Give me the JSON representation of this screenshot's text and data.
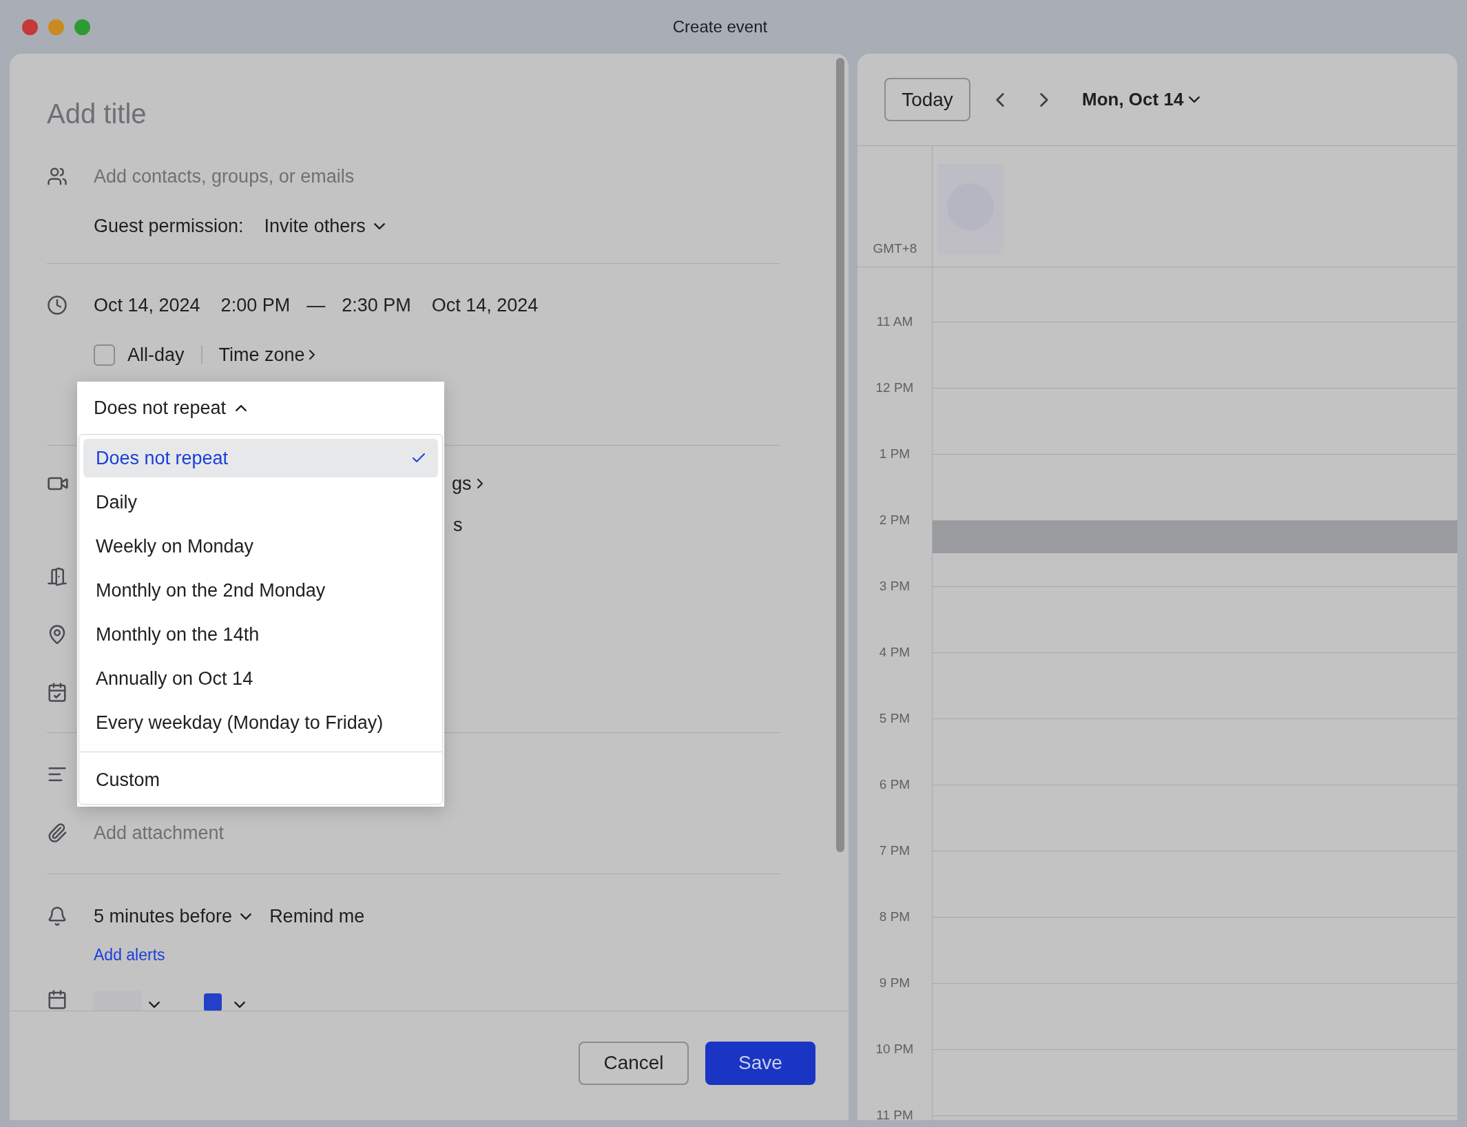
{
  "window": {
    "title": "Create event"
  },
  "form": {
    "title_placeholder": "Add title",
    "guests_placeholder": "Add contacts, groups, or emails",
    "guest_permission": {
      "label": "Guest permission:",
      "value": "Invite others"
    },
    "date_time": {
      "start_date": "Oct 14, 2024",
      "start_time": "2:00 PM",
      "separator": "—",
      "end_time": "2:30 PM",
      "end_date": "Oct 14, 2024"
    },
    "all_day": {
      "label": "All-day",
      "checked": false
    },
    "time_zone": "Time zone",
    "repeat": {
      "value": "Does not repeat",
      "expanded": true,
      "options": [
        {
          "label": "Does not repeat",
          "selected": true,
          "divider_before": false
        },
        {
          "label": "Daily",
          "selected": false,
          "divider_before": false
        },
        {
          "label": "Weekly on Monday",
          "selected": false,
          "divider_before": false
        },
        {
          "label": "Monthly on the 2nd Monday",
          "selected": false,
          "divider_before": false
        },
        {
          "label": "Monthly on the 14th",
          "selected": false,
          "divider_before": false
        },
        {
          "label": "Annually on Oct 14",
          "selected": false,
          "divider_before": false
        },
        {
          "label": "Every weekday (Monday to Friday)",
          "selected": false,
          "divider_before": false
        },
        {
          "label": "Custom",
          "selected": false,
          "divider_before": true
        }
      ]
    },
    "obscured_texts": [
      "gs",
      "s"
    ],
    "attachment_placeholder": "Add attachment",
    "alert": {
      "value": "5 minutes before",
      "action": "Remind me"
    },
    "add_alerts": "Add alerts"
  },
  "footer": {
    "buttons": [
      {
        "label": "Cancel",
        "kind": "secondary"
      },
      {
        "label": "Save",
        "kind": "primary"
      }
    ]
  },
  "calendar": {
    "today": "Today",
    "date": "Mon, Oct 14",
    "timezone": "GMT+8",
    "hours": [
      {
        "label": "11 AM",
        "event": false
      },
      {
        "label": "12 PM",
        "event": false
      },
      {
        "label": "1 PM",
        "event": false
      },
      {
        "label": "2 PM",
        "event": true
      },
      {
        "label": "3 PM",
        "event": false
      },
      {
        "label": "4 PM",
        "event": false
      },
      {
        "label": "5 PM",
        "event": false
      },
      {
        "label": "6 PM",
        "event": false
      },
      {
        "label": "7 PM",
        "event": false
      },
      {
        "label": "8 PM",
        "event": false
      },
      {
        "label": "9 PM",
        "event": false
      },
      {
        "label": "10 PM",
        "event": false
      },
      {
        "label": "11 PM",
        "event": false
      }
    ]
  }
}
